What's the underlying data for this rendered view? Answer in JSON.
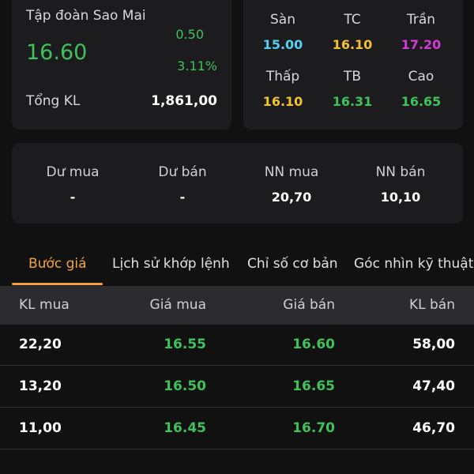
{
  "stock": {
    "company": "Tập đoàn Sao Mai",
    "price": "16.60",
    "change": "0.50",
    "change_pct": "3.11%",
    "volume_label": "Tổng KL",
    "volume_value": "1,861,00"
  },
  "price_levels": [
    {
      "label": "Sàn",
      "value": "15.00",
      "color": "#55d0f0"
    },
    {
      "label": "TC",
      "value": "16.10",
      "color": "#f2c230"
    },
    {
      "label": "Trần",
      "value": "17.20",
      "color": "#d43ad8"
    },
    {
      "label": "Thấp",
      "value": "16.10",
      "color": "#f2c230"
    },
    {
      "label": "TB",
      "value": "16.31",
      "color": "#3fc15b"
    },
    {
      "label": "Cao",
      "value": "16.65",
      "color": "#3fc15b"
    }
  ],
  "stats": [
    {
      "label": "Dư mua",
      "value": "-"
    },
    {
      "label": "Dư bán",
      "value": "-"
    },
    {
      "label": "NN mua",
      "value": "20,70"
    },
    {
      "label": "NN bán",
      "value": "10,10"
    }
  ],
  "tabs": [
    {
      "label": "Bước giá",
      "active": true
    },
    {
      "label": "Lịch sử khớp lệnh",
      "active": false
    },
    {
      "label": "Chỉ số cơ bản",
      "active": false
    },
    {
      "label": "Góc nhìn kỹ thuật",
      "active": false
    }
  ],
  "order_book": {
    "headers": [
      "KL mua",
      "Giá mua",
      "Giá bán",
      "KL bán"
    ],
    "rows": [
      [
        "22,20",
        "16.55",
        "16.60",
        "58,00"
      ],
      [
        "13,20",
        "16.50",
        "16.65",
        "47,40"
      ],
      [
        "11,00",
        "16.45",
        "16.70",
        "46,70"
      ]
    ]
  },
  "colors": {
    "up": "#3fc15b",
    "floor": "#55d0f0",
    "reference": "#f2c230",
    "ceiling": "#d43ad8",
    "accent": "#f3a43a"
  }
}
